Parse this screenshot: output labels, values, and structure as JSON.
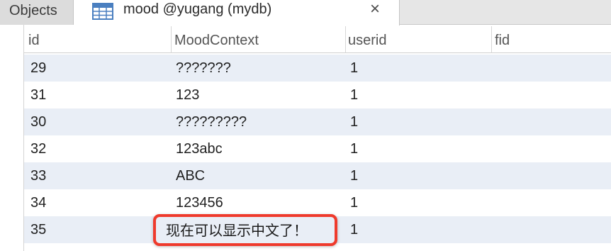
{
  "tabs": {
    "objects_label": "Objects",
    "active_title": "mood @yugang (mydb)",
    "close_icon": "×",
    "table_icon": "table-grid-icon"
  },
  "table": {
    "columns": [
      "id",
      "MoodContext",
      "userid",
      "fid"
    ],
    "rows": [
      {
        "id": "29",
        "MoodContext": "???????",
        "userid": "1",
        "fid": ""
      },
      {
        "id": "31",
        "MoodContext": "123",
        "userid": "1",
        "fid": ""
      },
      {
        "id": "30",
        "MoodContext": "?????????",
        "userid": "1",
        "fid": ""
      },
      {
        "id": "32",
        "MoodContext": "123abc",
        "userid": "1",
        "fid": ""
      },
      {
        "id": "33",
        "MoodContext": "ABC",
        "userid": "1",
        "fid": ""
      },
      {
        "id": "34",
        "MoodContext": "123456",
        "userid": "1",
        "fid": ""
      },
      {
        "id": "35",
        "MoodContext": "现在可以显示中文了！",
        "userid": "1",
        "fid": ""
      }
    ]
  },
  "colors": {
    "highlight_border": "#ef3a2c",
    "row_stripe": "#e9eef6"
  }
}
